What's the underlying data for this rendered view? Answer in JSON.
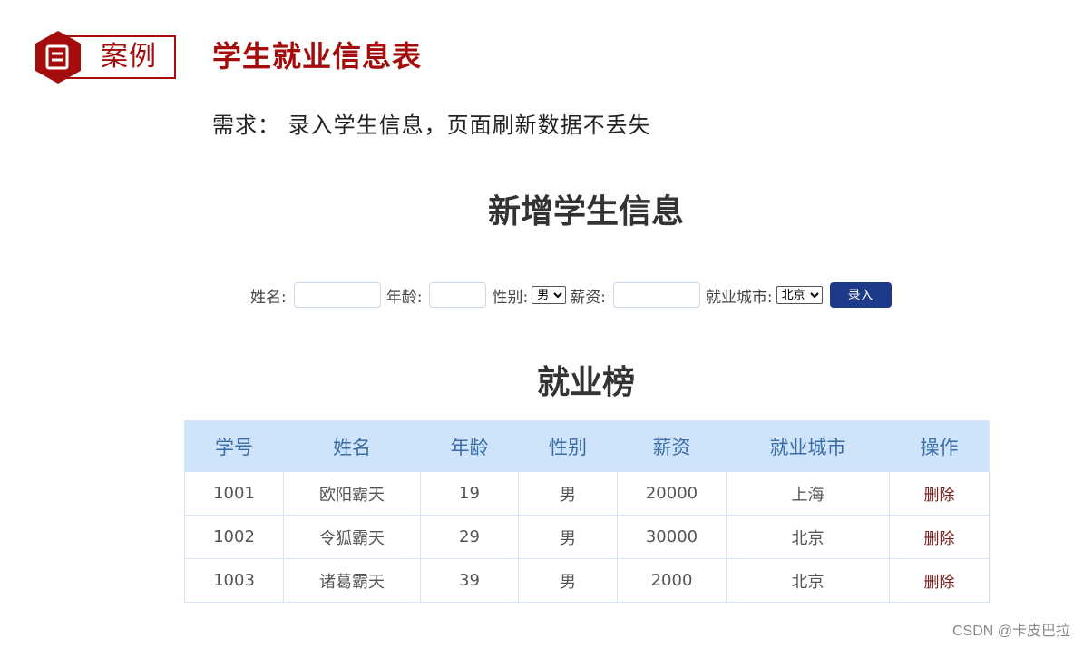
{
  "header": {
    "badge_label": "案例",
    "case_title": "学生就业信息表",
    "requirement": "需求： 录入学生信息，页面刷新数据不丢失"
  },
  "form": {
    "title": "新增学生信息",
    "name_label": "姓名:",
    "age_label": "年龄:",
    "gender_label": "性别:",
    "gender_selected": "男",
    "salary_label": "薪资:",
    "city_label": "就业城市:",
    "city_selected": "北京",
    "submit_label": "录入"
  },
  "table": {
    "title": "就业榜",
    "headers": [
      "学号",
      "姓名",
      "年龄",
      "性别",
      "薪资",
      "就业城市",
      "操作"
    ],
    "rows": [
      [
        "1001",
        "欧阳霸天",
        "19",
        "男",
        "20000",
        "上海",
        "删除"
      ],
      [
        "1002",
        "令狐霸天",
        "29",
        "男",
        "30000",
        "北京",
        "删除"
      ],
      [
        "1003",
        "诸葛霸天",
        "39",
        "男",
        "2000",
        "北京",
        "删除"
      ]
    ]
  },
  "watermark": "CSDN @卡皮巴拉",
  "colors": {
    "brand_red": "#a50d0d",
    "button_blue": "#1d3a8a",
    "table_header_bg": "#cfe3fb",
    "table_header_text": "#3b6ea5"
  }
}
